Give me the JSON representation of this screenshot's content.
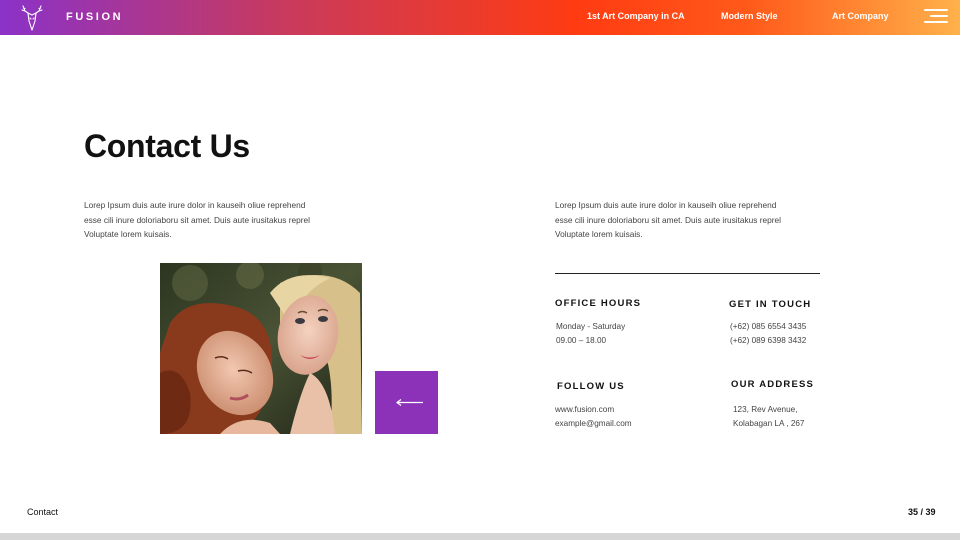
{
  "header": {
    "brand": "FUSION",
    "logo_icon": "deer-head-icon",
    "nav": [
      "1st Art Company in CA",
      "Modern Style",
      "Art Company"
    ],
    "menu_icon": "hamburger-menu-icon",
    "gradient": [
      "#8a32c8",
      "#ff3b12",
      "#ffb14a"
    ]
  },
  "main": {
    "title": "Contact Us",
    "left_paragraph": [
      "Lorep  Ipsum duis aute irure dolor in kauseih oliue reprehend",
      "esse cili inure doloriaboru sit amet. Duis aute irusitakus reprel",
      "Voluptate lorem kuisais."
    ],
    "right_paragraph": [
      "Lorep  Ipsum duis aute irure dolor in kauseih oliue reprehend",
      "esse cili inure doloriaboru sit amet. Duis aute irusitakus reprel",
      "Voluptate lorem kuisais."
    ],
    "photo": "two-women-portrait",
    "arrow_icon": "arrow-left-icon",
    "accent_color": "#8b32b8"
  },
  "contact": {
    "office_hours": {
      "heading": "OFFICE HOURS",
      "lines": [
        "Monday - Saturday",
        "09.00 – 18.00"
      ]
    },
    "get_in_touch": {
      "heading": "GET IN TOUCH",
      "lines": [
        "(+62) 085 6554 3435",
        "(+62) 089 6398 3432"
      ]
    },
    "follow_us": {
      "heading": "FOLLOW US",
      "lines": [
        "www.fusion.com",
        "example@gmail.com"
      ]
    },
    "our_address": {
      "heading": "OUR ADDRESS",
      "lines": [
        "123, Rev Avenue,",
        "Kolabagan LA , 267"
      ]
    }
  },
  "footer": {
    "section_label": "Contact",
    "page_indicator": "35 / 39"
  }
}
